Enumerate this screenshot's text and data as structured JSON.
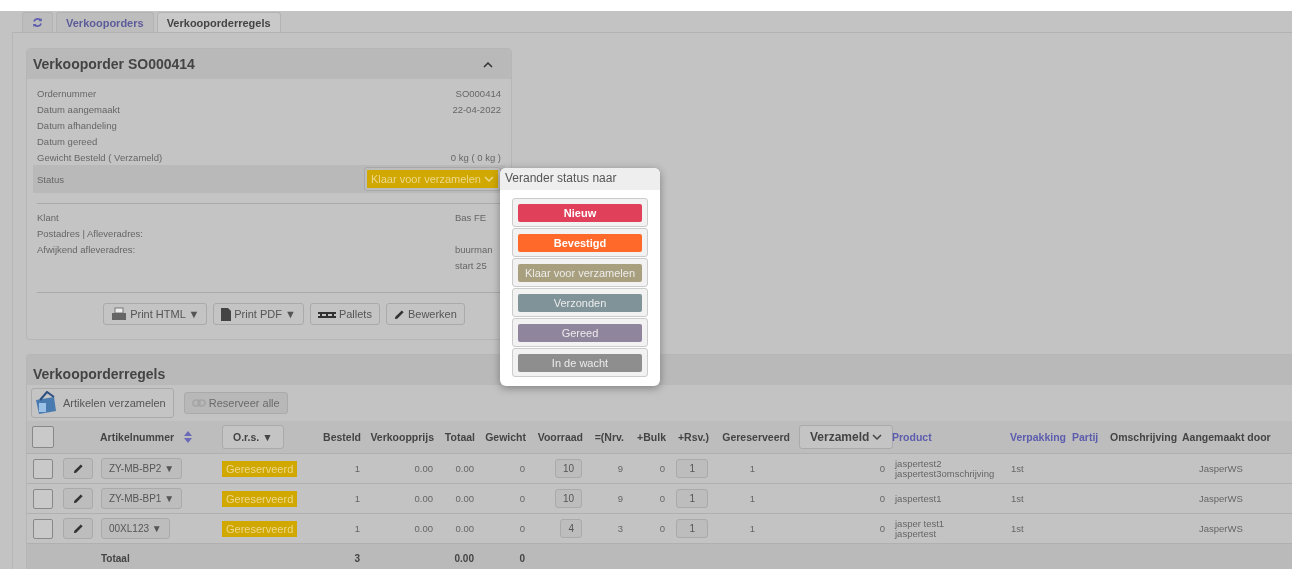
{
  "tabs": [
    {
      "kind": "icon",
      "selected": false
    },
    {
      "kind": "text",
      "label": "Verkooporders",
      "selected": false
    },
    {
      "kind": "text",
      "label": "Verkooporderregels",
      "selected": true
    }
  ],
  "order_panel": {
    "title": "Verkooporder SO000414",
    "expanded": true,
    "fields": [
      {
        "label": "Ordernummer",
        "value": "SO000414"
      },
      {
        "label": "Datum aangemaakt",
        "value": "22-04-2022"
      },
      {
        "label": "Datum afhandeling"
      },
      {
        "label": "Datum gereed"
      },
      {
        "label": "Gewicht Besteld ( Verzameld)",
        "value": "0 kg ( 0 kg )"
      }
    ],
    "status": {
      "label": "Status",
      "value": "Klaar voor verzamelen"
    },
    "customer_fields": [
      {
        "label": "Klant",
        "value": [
          "Bas FE"
        ]
      },
      {
        "label": "Postadres | Afleveradres:"
      },
      {
        "label": "Afwijkend afleveradres:",
        "value": [
          "buurman",
          "start 25"
        ]
      }
    ],
    "buttons": [
      {
        "kind": "html",
        "label": "Print HTML ▼"
      },
      {
        "kind": "pdf",
        "label": "Print PDF ▼"
      },
      {
        "kind": "pallets",
        "label": "Pallets"
      },
      {
        "kind": "edit",
        "label": "Bewerken"
      }
    ]
  },
  "status_popup": {
    "title": "Verander status naar",
    "options": [
      {
        "label": "Nieuw",
        "color": "#e0405a",
        "disabled": false
      },
      {
        "label": "Bevestigd",
        "color": "#ff6a2a",
        "disabled": false
      },
      {
        "label": "Klaar voor verzamelen",
        "color": "#a89f7e",
        "disabled": true
      },
      {
        "label": "Verzonden",
        "color": "#7f9398",
        "disabled": true
      },
      {
        "label": "Gereed",
        "color": "#8f859d",
        "disabled": true
      },
      {
        "label": "In de wacht",
        "color": "#8e8e8e",
        "disabled": true
      }
    ]
  },
  "lines_section": {
    "title": "Verkooporderregels",
    "toolbar": [
      {
        "kind": "collect",
        "label": "Artikelen verzamelen",
        "disabled": false
      },
      {
        "kind": "link",
        "label": "Reserveer alle",
        "disabled": true
      }
    ],
    "select_all": {
      "checked": false
    },
    "columns": [
      {
        "label": "Artikelnummer",
        "kind": "sort"
      },
      {
        "label": "O.r.s. ▼",
        "kind": "menu"
      },
      {
        "label": "Besteld",
        "kind": "text"
      },
      {
        "label": "Verkoopprijs",
        "kind": "text"
      },
      {
        "label": "Totaal",
        "kind": "text"
      },
      {
        "label": "Gewicht",
        "kind": "text"
      },
      {
        "label": "Voorraad",
        "kind": "text"
      },
      {
        "label": "=(Nrv.",
        "kind": "text"
      },
      {
        "label": "+Bulk",
        "kind": "text"
      },
      {
        "label": "+Rsv.)",
        "kind": "text"
      },
      {
        "label": "Gereserveerd",
        "kind": "text"
      },
      {
        "label": "Verzameld",
        "kind": "dropdown"
      },
      {
        "label": "Product",
        "kind": "link"
      },
      {
        "label": "Verpakking",
        "kind": "link"
      },
      {
        "label": "Partij",
        "kind": "link"
      },
      {
        "label": "Omschrijving",
        "kind": "text"
      },
      {
        "label": "Aangemaakt door",
        "kind": "text"
      }
    ],
    "rows": [
      {
        "checked": false,
        "artikelnummer": "ZY-MB-BP2 ▼",
        "ors": "Gereserveerd",
        "besteld": "1",
        "verkoopprijs": "0.00",
        "totaal": "0.00",
        "gewicht": "0",
        "voorraad": "10",
        "nrv": "9",
        "bulk": "0",
        "rsv": "1",
        "gereserveerd": "1",
        "verzameld": "0",
        "product": [
          "jaspertest2",
          "jaspertest3omschrijving"
        ],
        "verpakking": "1st",
        "aangemaakt_door": "JasperWS"
      },
      {
        "checked": false,
        "artikelnummer": "ZY-MB-BP1 ▼",
        "ors": "Gereserveerd",
        "besteld": "1",
        "verkoopprijs": "0.00",
        "totaal": "0.00",
        "gewicht": "0",
        "voorraad": "10",
        "nrv": "9",
        "bulk": "0",
        "rsv": "1",
        "gereserveerd": "1",
        "verzameld": "0",
        "product": [
          "jaspertest1"
        ],
        "verpakking": "1st",
        "aangemaakt_door": "JasperWS"
      },
      {
        "checked": false,
        "artikelnummer": "00XL123 ▼",
        "ors": "Gereserveerd",
        "besteld": "1",
        "verkoopprijs": "0.00",
        "totaal": "0.00",
        "gewicht": "0",
        "voorraad": "4",
        "nrv": "3",
        "bulk": "0",
        "rsv": "1",
        "gereserveerd": "1",
        "verzameld": "0",
        "product": [
          "jasper test1",
          "jaspertest"
        ],
        "verpakking": "1st",
        "aangemaakt_door": "JasperWS"
      }
    ],
    "total": {
      "label": "Totaal",
      "besteld": "3",
      "totaal": "0.00",
      "gewicht": "0"
    }
  }
}
